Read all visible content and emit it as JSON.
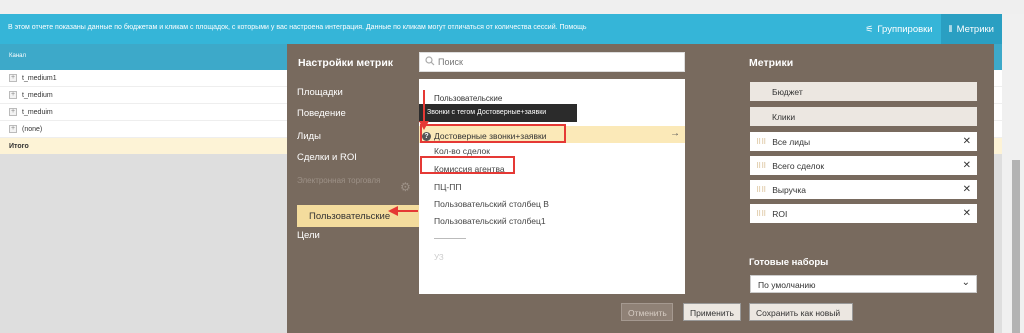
{
  "report": {
    "info_text": "В этом отчете показаны данные по бюджетам и кликам с площадок, с которыми у вас настроена интеграция. Данные по кликам могут отличаться от количества сессий. Помощь",
    "groupings_label": "Группировки",
    "metrics_label": "Метрики",
    "column_header": "Канал",
    "rows": [
      "t_medium1",
      "t_medium",
      "t_meduim",
      "(none)"
    ],
    "total_label": "Итого"
  },
  "modal": {
    "title": "Настройки метрик",
    "categories": [
      "Площадки",
      "Поведение",
      "Лиды",
      "Сделки и ROI"
    ],
    "disabled_category": "Электронная торговля",
    "active_category": "Пользовательские",
    "last_category": "Цели",
    "search_placeholder": "Поиск",
    "list_header": "Пользовательские",
    "tooltip": "Звонки с тегом Достоверные+заявки",
    "highlighted_item": "Достоверные звонки+заявки",
    "items": [
      "Кол-во сделок",
      "Комиссия агентва",
      "ПЦ-ПП",
      "Пользовательский столбец В",
      "Пользовательский столбец1"
    ],
    "faded_item": "УЗ",
    "metrics_title": "Метрики",
    "fixed_metrics": [
      "Бюджет",
      "Клики"
    ],
    "removable_metrics": [
      "Все лиды",
      "Всего сделок",
      "Выручка",
      "ROI"
    ],
    "presets_title": "Готовые наборы",
    "preset_value": "По умолчанию",
    "cancel": "Отменить",
    "apply": "Применить",
    "save_as_new": "Сохранить как новый"
  },
  "colors": {
    "infobar": "#35b5d8",
    "modal_bg": "#786a5e",
    "active_category": "#f4dc9d",
    "highlight_row": "#fbe9b8",
    "annotation_red": "#e53935"
  }
}
